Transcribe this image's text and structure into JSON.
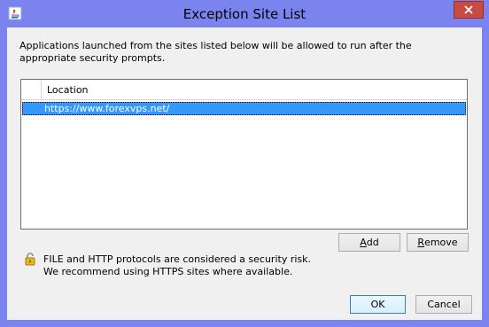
{
  "window": {
    "title": "Exception Site List",
    "close_icon": "close-icon",
    "app_icon": "java-icon"
  },
  "description": "Applications launched from the sites listed below will be allowed to run after the appropriate security prompts.",
  "table": {
    "column_header": "Location",
    "rows": [
      {
        "location": "https://www.forexvps.net/",
        "selected": true
      }
    ]
  },
  "buttons": {
    "add": {
      "mnemonic": "A",
      "rest": "dd"
    },
    "remove": {
      "mnemonic": "R",
      "rest": "emove"
    },
    "ok": "OK",
    "cancel": "Cancel"
  },
  "warning": {
    "icon": "lock-icon",
    "line1": "FILE and HTTP protocols are considered a security risk.",
    "line2": "We recommend using HTTPS sites where available."
  },
  "colors": {
    "frame": "#7b84ee",
    "selection": "#3399ff",
    "close_button": "#c74b43"
  }
}
